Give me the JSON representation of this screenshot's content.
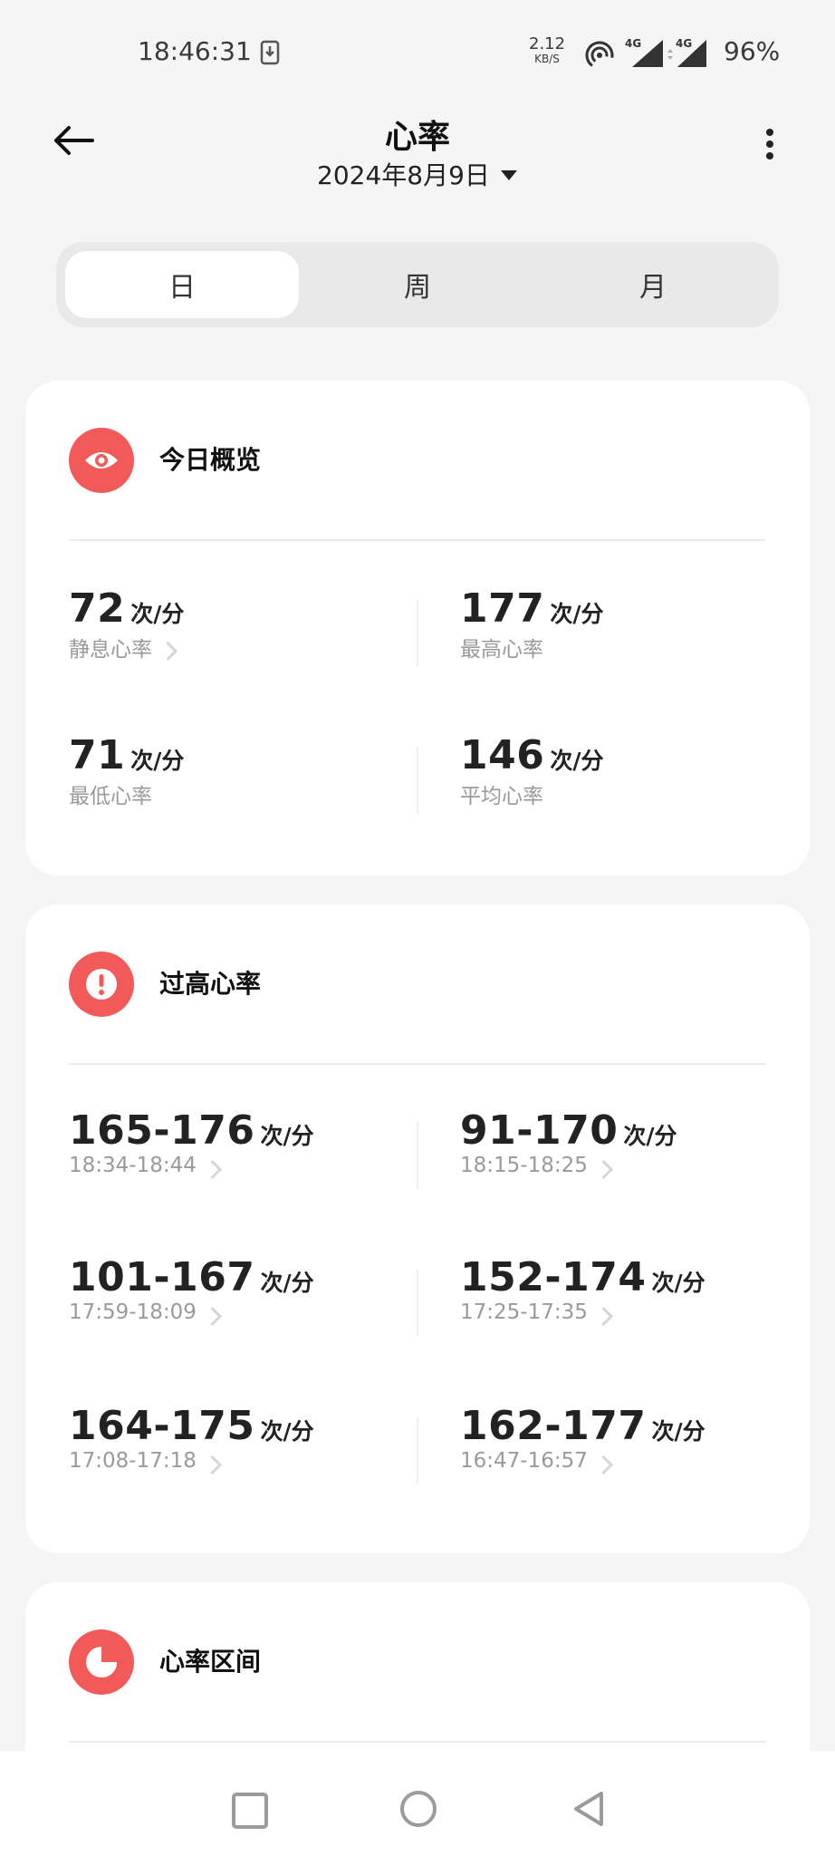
{
  "status_bar": {
    "time": "18:46:31",
    "net_speed": "2.12",
    "net_unit": "KB/S",
    "signal1": "4G",
    "signal2": "4G",
    "battery": "96%"
  },
  "header": {
    "title": "心率",
    "date": "2024年8月9日"
  },
  "tabs": [
    {
      "label": "日",
      "active": true
    },
    {
      "label": "周",
      "active": false
    },
    {
      "label": "月",
      "active": false
    }
  ],
  "overview": {
    "title": "今日概览",
    "unit": "次/分",
    "stats": [
      {
        "value": "72",
        "label": "静息心率"
      },
      {
        "value": "177",
        "label": "最高心率"
      },
      {
        "value": "71",
        "label": "最低心率"
      },
      {
        "value": "146",
        "label": "平均心率"
      }
    ]
  },
  "high_hr": {
    "title": "过高心率",
    "unit": "次/分",
    "items": [
      {
        "range": "165-176",
        "time": "18:34-18:44"
      },
      {
        "range": "91-170",
        "time": "18:15-18:25"
      },
      {
        "range": "101-167",
        "time": "17:59-18:09"
      },
      {
        "range": "152-174",
        "time": "17:25-17:35"
      },
      {
        "range": "164-175",
        "time": "17:08-17:18"
      },
      {
        "range": "162-177",
        "time": "16:47-16:57"
      }
    ]
  },
  "zones": {
    "title": "心率区间"
  },
  "colors": {
    "accent": "#f25a5a",
    "background": "#f5f5f5",
    "card": "#ffffff"
  }
}
